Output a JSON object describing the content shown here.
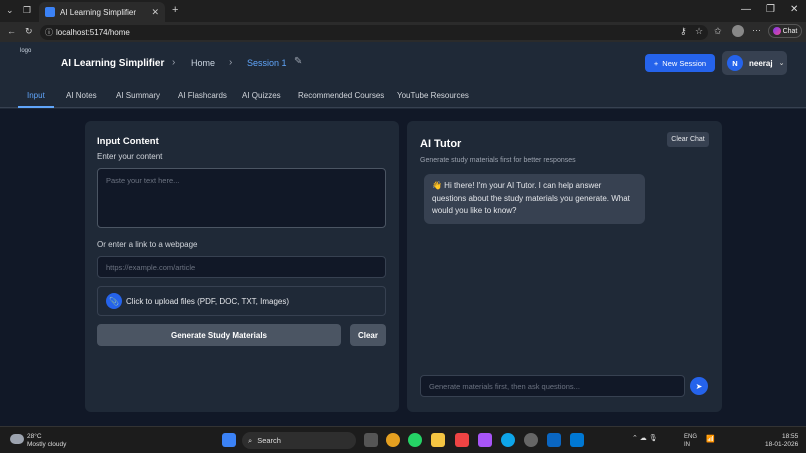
{
  "browser": {
    "tab_title": "AI Learning Simplifier",
    "url": "localhost:5174/home",
    "chat_label": "Chat"
  },
  "header": {
    "logo_alt": "logo",
    "app_title": "AI Learning Simplifier",
    "breadcrumb_home": "Home",
    "breadcrumb_session": "Session 1",
    "new_session_label": "New Session",
    "user_initial": "N",
    "user_name": "neeraj"
  },
  "tabs": [
    "Input",
    "AI Notes",
    "AI Summary",
    "AI Flashcards",
    "AI Quizzes",
    "Recommended Courses",
    "YouTube Resources"
  ],
  "input_panel": {
    "title": "Input Content",
    "content_label": "Enter your content",
    "content_placeholder": "Paste your text here...",
    "link_label": "Or enter a link to a webpage",
    "link_placeholder": "https://example.com/article",
    "upload_label": "Click to upload files (PDF, DOC, TXT, Images)",
    "generate_label": "Generate Study Materials",
    "clear_label": "Clear"
  },
  "tutor_panel": {
    "title": "AI Tutor",
    "subtitle": "Generate study materials first for better responses",
    "clear_chat_label": "Clear Chat",
    "greeting": "👋 Hi there! I'm your AI Tutor. I can help answer questions about the study materials you generate. What would you like to know?",
    "chat_placeholder": "Generate materials first, then ask questions..."
  },
  "taskbar": {
    "temperature": "28°C",
    "weather": "Mostly cloudy",
    "search_label": "Search",
    "lang_top": "ENG",
    "lang_bottom": "IN",
    "time": "18:55",
    "date": "18-01-2026"
  }
}
